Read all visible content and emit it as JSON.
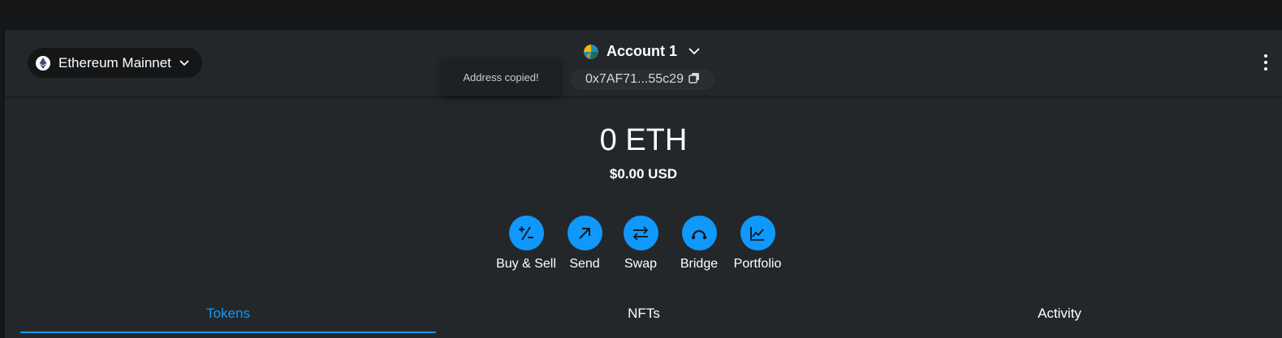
{
  "header": {
    "network": {
      "label": "Ethereum Mainnet",
      "icon": "ethereum-icon"
    },
    "account": {
      "name": "Account 1",
      "avatar": "jazzicon-avatar"
    },
    "address": {
      "short": "0x7AF71...55c29",
      "copy_icon": "copy-icon"
    },
    "tooltip": "Address copied!",
    "menu_icon": "kebab-menu-icon"
  },
  "balance": {
    "primary": "0 ETH",
    "fiat": "$0.00 USD"
  },
  "actions": [
    {
      "label": "Buy & Sell",
      "icon": "buy-sell-icon"
    },
    {
      "label": "Send",
      "icon": "arrow-up-right-icon"
    },
    {
      "label": "Swap",
      "icon": "swap-arrows-icon"
    },
    {
      "label": "Bridge",
      "icon": "bridge-icon"
    },
    {
      "label": "Portfolio",
      "icon": "chart-icon"
    }
  ],
  "tabs": [
    {
      "label": "Tokens",
      "active": true
    },
    {
      "label": "NFTs",
      "active": false
    },
    {
      "label": "Activity",
      "active": false
    }
  ],
  "colors": {
    "accent": "#1098fc",
    "background": "#24272a",
    "outer": "#141618"
  }
}
